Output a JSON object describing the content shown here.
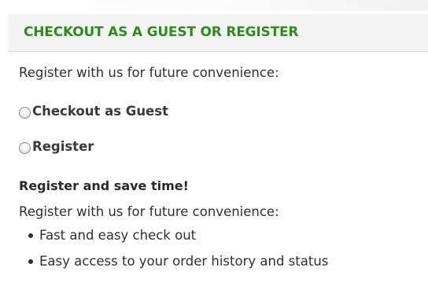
{
  "header": {
    "title": "CHECKOUT AS A GUEST OR REGISTER"
  },
  "intro_text": "Register with us for future convenience:",
  "options": [
    {
      "label": "Checkout as Guest",
      "selected": false
    },
    {
      "label": "Register",
      "selected": false
    }
  ],
  "register_section": {
    "heading": "Register and save time!",
    "text": "Register with us for future convenience:",
    "benefits": [
      "Fast and easy check out",
      "Easy access to your order history and status"
    ]
  },
  "colors": {
    "title_green": "#2f8a1f",
    "text": "#2f2f2f",
    "header_bg": "#f4f4f4"
  },
  "icons": {
    "radio": "radio-button-icon",
    "bullet": "bullet-icon"
  }
}
